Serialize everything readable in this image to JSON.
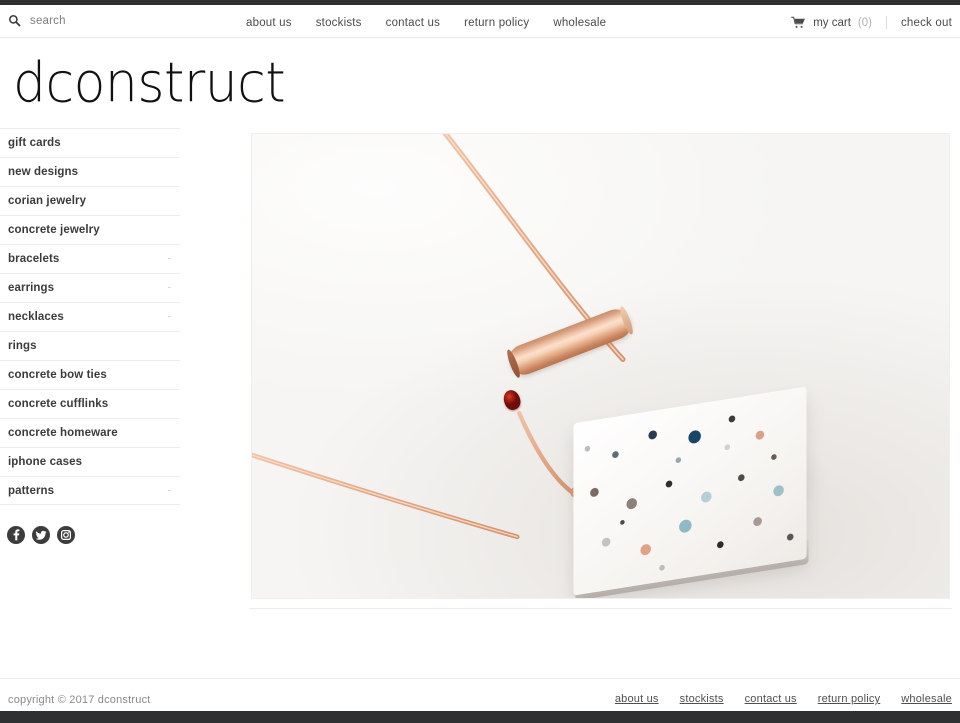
{
  "site": {
    "logo_text": "dconstruct",
    "logo_lead": "d",
    "logo_rest": "construct"
  },
  "utility_bar": {
    "search": {
      "icon": "search-icon",
      "placeholder": "search",
      "value": ""
    },
    "nav": [
      {
        "label": "about us"
      },
      {
        "label": "stockists"
      },
      {
        "label": "contact us"
      },
      {
        "label": "return policy"
      },
      {
        "label": "wholesale"
      }
    ],
    "cart": {
      "icon": "shopping-cart-icon",
      "label": "my cart",
      "count": "(0)"
    },
    "checkout_label": "check out"
  },
  "sidebar": {
    "items": [
      {
        "label": "gift cards",
        "toggle": ""
      },
      {
        "label": "new designs",
        "toggle": ""
      },
      {
        "label": "corian jewelry",
        "toggle": ""
      },
      {
        "label": "concrete jewelry",
        "toggle": ""
      },
      {
        "label": "bracelets",
        "toggle": "-"
      },
      {
        "label": "earrings",
        "toggle": "-"
      },
      {
        "label": "necklaces",
        "toggle": "-"
      },
      {
        "label": "rings",
        "toggle": ""
      },
      {
        "label": "concrete bow ties",
        "toggle": ""
      },
      {
        "label": "concrete cufflinks",
        "toggle": ""
      },
      {
        "label": "concrete homeware",
        "toggle": ""
      },
      {
        "label": "iphone cases",
        "toggle": ""
      },
      {
        "label": "patterns",
        "toggle": "-"
      }
    ],
    "social": [
      {
        "name": "facebook-icon",
        "label": "Facebook"
      },
      {
        "name": "twitter-icon",
        "label": "Twitter"
      },
      {
        "name": "instagram-icon",
        "label": "Instagram"
      }
    ]
  },
  "main": {
    "product_photo_alt": "rose gold bar necklace with white terrazzo concrete pendant on a light grey background"
  },
  "footer": {
    "copyright": "copyright © 2017 dconstruct",
    "links": [
      {
        "label": "about us"
      },
      {
        "label": "stockists"
      },
      {
        "label": "contact us"
      },
      {
        "label": "return policy"
      },
      {
        "label": "wholesale"
      }
    ]
  },
  "colors": {
    "rail": "#2f3031",
    "text": "#3b3b3b",
    "muted": "#8a8a8a",
    "rule": "#ededed",
    "copper": "#e0a87e",
    "ruby": "#a51d14"
  }
}
